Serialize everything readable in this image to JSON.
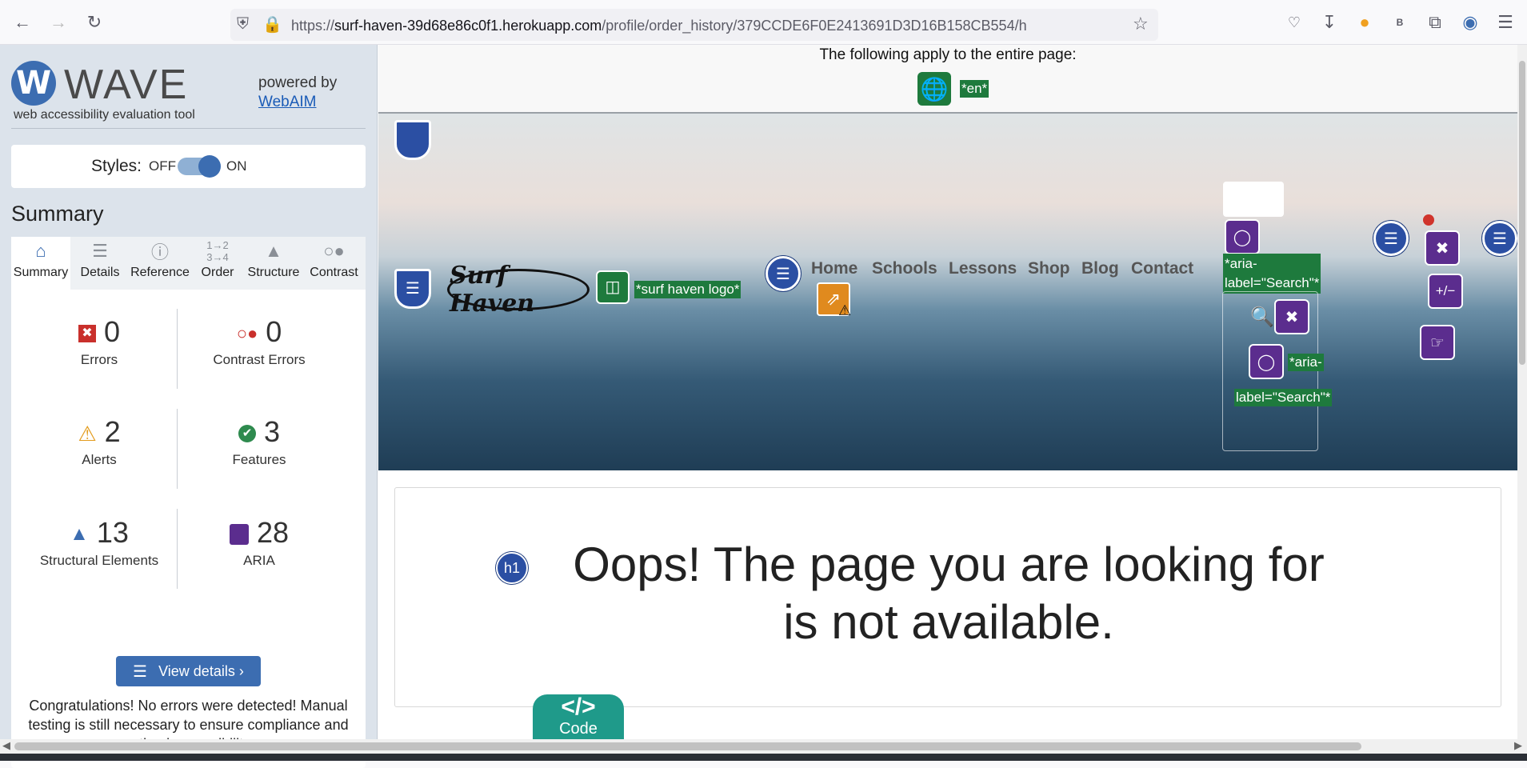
{
  "browser": {
    "url_prefix": "https://",
    "url_host": "surf-haven-39d68e86c0f1.herokuapp.com",
    "url_path": "/profile/order_history/379CCDE6F0E2413691D3D16B158CB554/h",
    "profile_initial": "B"
  },
  "wave": {
    "logo_letter": "W",
    "title": "WAVE",
    "subtitle": "web accessibility evaluation tool",
    "powered_by": "powered by",
    "powered_link": "WebAIM",
    "styles_label": "Styles:",
    "styles_off": "OFF",
    "styles_on": "ON",
    "summary_heading": "Summary",
    "tabs": [
      {
        "label": "Summary",
        "icon": "home-icon"
      },
      {
        "label": "Details",
        "icon": "list-icon"
      },
      {
        "label": "Reference",
        "icon": "info-icon"
      },
      {
        "label": "Order",
        "icon": "order-icon"
      },
      {
        "label": "Structure",
        "icon": "structure-icon"
      },
      {
        "label": "Contrast",
        "icon": "contrast-icon"
      }
    ],
    "stats": {
      "errors": {
        "value": "0",
        "label": "Errors"
      },
      "contrast_errors": {
        "value": "0",
        "label": "Contrast Errors"
      },
      "alerts": {
        "value": "2",
        "label": "Alerts"
      },
      "features": {
        "value": "3",
        "label": "Features"
      },
      "structural": {
        "value": "13",
        "label": "Structural Elements"
      },
      "aria": {
        "value": "28",
        "label": "ARIA"
      }
    },
    "view_details": "View details ›",
    "congrats": "Congratulations! No errors were detected! Manual testing is still necessary to ensure compliance and optimal accessibility."
  },
  "page": {
    "apply_text": "The following apply to the entire page:",
    "lang_tag": "*en*",
    "logo_text": "Surf Haven",
    "logo_alt_tag": "*surf haven logo*",
    "nav": [
      "Home",
      "Schools",
      "Lessons",
      "Shop",
      "Blog",
      "Contact"
    ],
    "aria_label_1": "*aria-label=\"Search\"*",
    "aria_label_2a": "*aria-",
    "aria_label_2b": "label=\"Search\"*",
    "h1_badge": "h1",
    "heading": "Oops! The page you are looking for is not available.",
    "code_button": "Code",
    "code_glyph": "</>"
  },
  "colors": {
    "wave_blue": "#3c6db1",
    "aria_purple": "#5b2d8e",
    "feature_green": "#1e7a3d",
    "code_teal": "#1f9a8a"
  }
}
